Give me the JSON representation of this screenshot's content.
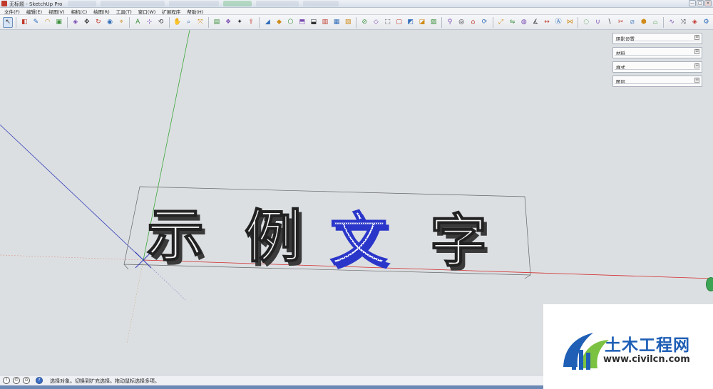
{
  "window": {
    "title": "无标题 - SketchUp Pro",
    "controls": [
      "—",
      "□",
      "×"
    ]
  },
  "menu": {
    "items": [
      "文件(F)",
      "编辑(E)",
      "视图(V)",
      "相机(C)",
      "绘图(R)",
      "工具(T)",
      "窗口(W)",
      "扩展程序",
      "帮助(H)"
    ]
  },
  "toolbar": {
    "tools": [
      {
        "name": "select-icon",
        "glyph": "↖",
        "active": true
      },
      {
        "name": "eraser-icon",
        "glyph": "◧"
      },
      {
        "name": "line-icon",
        "glyph": "✎"
      },
      {
        "name": "arc-icon",
        "glyph": "◠"
      },
      {
        "name": "shape-icon",
        "glyph": "▣"
      },
      {
        "name": "push-pull-icon",
        "glyph": "◈"
      },
      {
        "name": "move-icon",
        "glyph": "✥"
      },
      {
        "name": "rotate-icon",
        "glyph": "↻"
      },
      {
        "name": "offset-icon",
        "glyph": "◉"
      },
      {
        "name": "tape-icon",
        "glyph": "⌖"
      },
      {
        "name": "text-icon",
        "glyph": "A"
      },
      {
        "name": "axes-icon",
        "glyph": "⊹"
      },
      {
        "name": "orbit-icon",
        "glyph": "⟲"
      },
      {
        "name": "pan-icon",
        "glyph": "✋"
      },
      {
        "name": "zoom-icon",
        "glyph": "⌕"
      },
      {
        "name": "zoom-extents-icon",
        "glyph": "⤧"
      },
      {
        "name": "warehouse-icon",
        "glyph": "▤"
      },
      {
        "name": "components-icon",
        "glyph": "❖"
      },
      {
        "name": "extension-icon",
        "glyph": "✦"
      },
      {
        "name": "share-icon",
        "glyph": "⇪"
      },
      {
        "name": "sandbox-icon",
        "glyph": "◢"
      },
      {
        "name": "solid-icon",
        "glyph": "◆"
      },
      {
        "name": "view-iso-icon",
        "glyph": "⬡"
      },
      {
        "name": "view-top-icon",
        "glyph": "⬒"
      },
      {
        "name": "view-front-icon",
        "glyph": "⬓"
      },
      {
        "name": "view-right-icon",
        "glyph": "▥"
      },
      {
        "name": "view-back-icon",
        "glyph": "▦"
      },
      {
        "name": "view-left-icon",
        "glyph": "▧"
      },
      {
        "name": "section-icon",
        "glyph": "⊘"
      },
      {
        "name": "xray-icon",
        "glyph": "◇"
      },
      {
        "name": "wireframe-icon",
        "glyph": "⬚"
      },
      {
        "name": "hidden-line-icon",
        "glyph": "▢"
      },
      {
        "name": "shaded-icon",
        "glyph": "◩"
      },
      {
        "name": "texture-icon",
        "glyph": "◪"
      },
      {
        "name": "mono-icon",
        "glyph": "▨"
      },
      {
        "name": "walk-icon",
        "glyph": "⚲"
      },
      {
        "name": "look-icon",
        "glyph": "◎"
      },
      {
        "name": "position-camera-icon",
        "glyph": "⌂"
      },
      {
        "name": "follow-me-icon",
        "glyph": "⟳"
      },
      {
        "name": "scale-icon",
        "glyph": "⤢"
      },
      {
        "name": "flip-icon",
        "glyph": "⇋"
      },
      {
        "name": "paint-icon",
        "glyph": "◍"
      },
      {
        "name": "protractor-icon",
        "glyph": "∡"
      },
      {
        "name": "dimension-icon",
        "glyph": "↔"
      },
      {
        "name": "3d-text-icon",
        "glyph": "Ⓐ"
      },
      {
        "name": "intersect-icon",
        "glyph": "⋈"
      },
      {
        "name": "outer-shell-icon",
        "glyph": "◌"
      },
      {
        "name": "union-icon",
        "glyph": "∪"
      },
      {
        "name": "subtract-icon",
        "glyph": "∖"
      },
      {
        "name": "trim-icon",
        "glyph": "✂"
      },
      {
        "name": "split-icon",
        "glyph": "⧄"
      },
      {
        "name": "stamp-icon",
        "glyph": "⬢"
      },
      {
        "name": "drape-icon",
        "glyph": "⌓"
      },
      {
        "name": "smoove-icon",
        "glyph": "∿"
      },
      {
        "name": "flip-edge-icon",
        "glyph": "⤨"
      },
      {
        "name": "ruby-icon",
        "glyph": "◈"
      },
      {
        "name": "plugin-icon",
        "glyph": "⚙"
      }
    ]
  },
  "tray": {
    "panels": [
      {
        "label": "阴影设置"
      },
      {
        "label": "材料"
      },
      {
        "label": "样式"
      },
      {
        "label": "图层"
      }
    ],
    "pin_glyph": "⊟"
  },
  "scene": {
    "text_3d": [
      "示",
      "例",
      "文",
      "字"
    ],
    "colors": {
      "axis_red": "#d22b2b",
      "axis_green": "#39a83a",
      "axis_blue": "#2e3ab8",
      "selection_blue": "#2a36c9",
      "bbox": "#555555"
    }
  },
  "statusbar": {
    "text": "选择对象。切换到扩充选择。拖动鼠标选择多项。",
    "icons": [
      "!",
      "©",
      "⊙",
      "?"
    ]
  },
  "watermark": {
    "title": "土木工程网",
    "url": "www.civilcn.com"
  }
}
